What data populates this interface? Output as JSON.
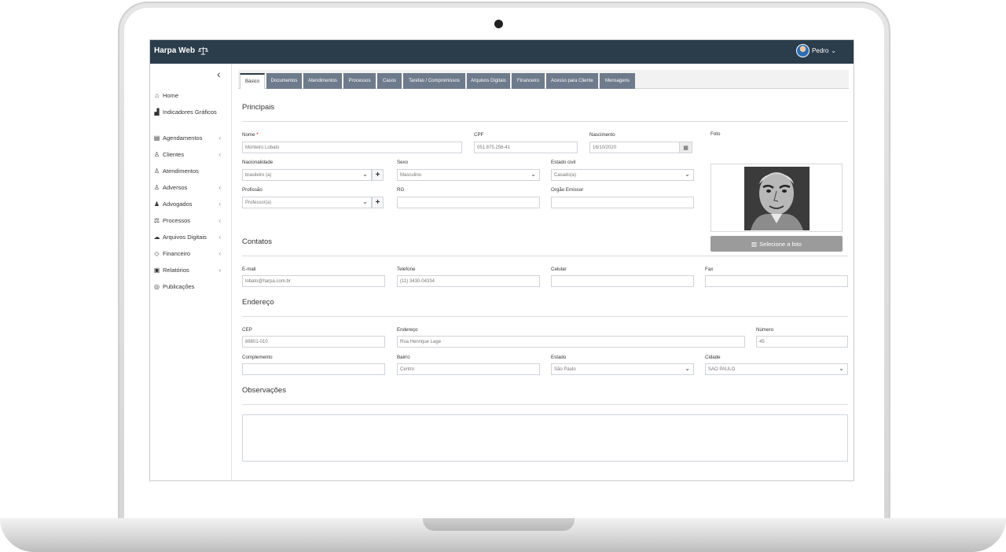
{
  "app": {
    "brand": "Harpa Web",
    "user_name": "Pedro"
  },
  "sidebar": {
    "items": [
      {
        "label": "Home",
        "icon": "home-icon"
      },
      {
        "label": "Indicadores Gráficos",
        "icon": "bar-chart-icon"
      },
      {
        "label": "Agendamentos",
        "icon": "calendar-icon"
      },
      {
        "label": "Clientes",
        "icon": "user-icon"
      },
      {
        "label": "Atendimentos",
        "icon": "users-icon"
      },
      {
        "label": "Adversos",
        "icon": "users-icon"
      },
      {
        "label": "Advogados",
        "icon": "lawyer-icon"
      },
      {
        "label": "Processos",
        "icon": "scale-icon"
      },
      {
        "label": "Arquivos Digitais",
        "icon": "cloud-icon"
      },
      {
        "label": "Financeiro",
        "icon": "tag-icon"
      },
      {
        "label": "Relatórios",
        "icon": "report-icon"
      },
      {
        "label": "Publicações",
        "icon": "database-icon"
      }
    ]
  },
  "tabs": [
    {
      "label": "Básico"
    },
    {
      "label": "Documentos"
    },
    {
      "label": "Atendimentos"
    },
    {
      "label": "Processos"
    },
    {
      "label": "Casos"
    },
    {
      "label": "Tarefas / Compromissos"
    },
    {
      "label": "Arquivos Digitais"
    },
    {
      "label": "Financeiro"
    },
    {
      "label": "Acesso para Cliente"
    },
    {
      "label": "Mensagens"
    }
  ],
  "sections": {
    "principais": "Principais",
    "contatos": "Contatos",
    "endereco": "Endereço",
    "observacoes": "Observações"
  },
  "form": {
    "nome": {
      "label": "Nome",
      "required_mark": "*",
      "value": "Monteiro Lobato"
    },
    "cpf": {
      "label": "CPF",
      "value": "051.875.256-41"
    },
    "nascimento": {
      "label": "Nascimento",
      "value": "16/10/2020"
    },
    "foto": {
      "label": "Foto",
      "button": "Selecione a foto"
    },
    "nacionalidade": {
      "label": "Nacionalidade",
      "value": "brasileiro (a)"
    },
    "sexo": {
      "label": "Sexo",
      "value": "Masculino"
    },
    "estado_civil": {
      "label": "Estado civil",
      "value": "Casado(a)"
    },
    "profissao": {
      "label": "Profissão",
      "value": "Professor(a)"
    },
    "rg": {
      "label": "RG",
      "value": ""
    },
    "orgao_emissor": {
      "label": "Orgão Emissor",
      "value": ""
    },
    "email": {
      "label": "E-mail",
      "value": "lobato@harpa.com.br"
    },
    "telefone": {
      "label": "Telefone",
      "value": "(11) 3430-04334"
    },
    "celular": {
      "label": "Celular",
      "value": ""
    },
    "fax": {
      "label": "Fax",
      "value": ""
    },
    "cep": {
      "label": "CEP",
      "value": "88801-010"
    },
    "endereco": {
      "label": "Endereço",
      "value": "Rua Henrique Lage"
    },
    "numero": {
      "label": "Número",
      "value": "45"
    },
    "complemento": {
      "label": "Complemento",
      "value": ""
    },
    "bairro": {
      "label": "Bairro",
      "value": "Centro"
    },
    "estado": {
      "label": "Estado",
      "value": "São Paulo"
    },
    "cidade": {
      "label": "Cidade",
      "value": "SAO PAULO"
    },
    "add_symbol": "+"
  },
  "colors": {
    "topbar": "#2b3c4b",
    "tab": "#6e7b8c",
    "photo_button": "#9b9b9b"
  }
}
